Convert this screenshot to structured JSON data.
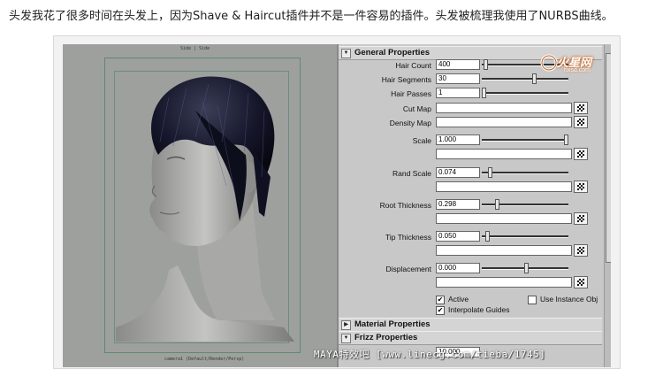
{
  "caption": "头发我花了很多时间在头发上，因为Shave & Haircut插件并不是一件容易的插件。头发被梳理我使用了NURBS曲线。",
  "viewport": {
    "top_label": "Side | Side",
    "bottom_label": "camera1 (Default/Render/Persp)"
  },
  "panel": {
    "general_header": "General Properties",
    "material_header": "Material Properties",
    "frizz_header": "Frizz Properties",
    "hair_count": {
      "label": "Hair Count",
      "value": "400",
      "level": 0.02
    },
    "hair_segments": {
      "label": "Hair Segments",
      "value": "30",
      "level": 0.6
    },
    "hair_passes": {
      "label": "Hair Passes",
      "value": "1",
      "level": 0.0
    },
    "cut_map": {
      "label": "Cut Map",
      "value": ""
    },
    "density_map": {
      "label": "Density Map",
      "value": ""
    },
    "scale": {
      "label": "Scale",
      "value": "1.000",
      "level": 0.98
    },
    "rand_scale": {
      "label": "Rand Scale",
      "value": "0.074",
      "level": 0.07
    },
    "root_thickness": {
      "label": "Root Thickness",
      "value": "0.298",
      "level": 0.15
    },
    "tip_thickness": {
      "label": "Tip Thickness",
      "value": "0.050",
      "level": 0.05
    },
    "displacement": {
      "label": "Displacement",
      "value": "0.000",
      "level": 0.5
    },
    "active": {
      "label": "Active",
      "checked": true
    },
    "interpolate_guides": {
      "label": "Interpolate Guides",
      "checked": true
    },
    "use_instance_obj": {
      "label": "Use Instance Obj",
      "checked": false
    },
    "frizz_value": "10.000"
  },
  "logo": {
    "main": "火星网",
    "sub": "hxsd.com"
  },
  "watermark": "MAYA特效吧 [www.linecg.com/tieba/1745]",
  "icons": {
    "collapse": "triangle-down-icon",
    "map_browse": "checker-map-icon"
  }
}
